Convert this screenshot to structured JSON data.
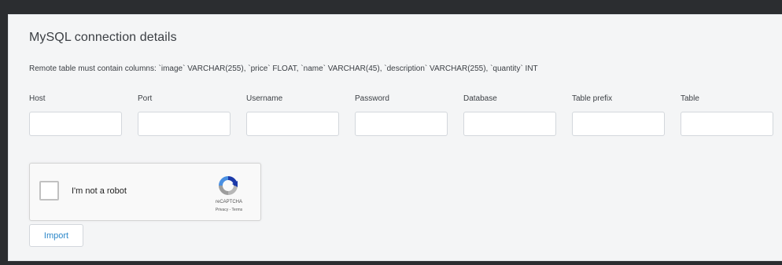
{
  "section": {
    "title": "MySQL connection details",
    "note": "Remote table must contain columns: `image` VARCHAR(255), `price` FLOAT, `name` VARCHAR(45), `description` VARCHAR(255), `quantity` INT"
  },
  "fields": [
    {
      "label": "Host",
      "value": ""
    },
    {
      "label": "Port",
      "value": ""
    },
    {
      "label": "Username",
      "value": ""
    },
    {
      "label": "Password",
      "value": ""
    },
    {
      "label": "Database",
      "value": ""
    },
    {
      "label": "Table prefix",
      "value": ""
    },
    {
      "label": "Table",
      "value": ""
    }
  ],
  "captcha": {
    "label": "I'm not a robot",
    "brand": "reCAPTCHA",
    "links": "Privacy - Terms",
    "checked": false
  },
  "actions": {
    "import_label": "Import"
  },
  "colors": {
    "background": "#2b2d30",
    "panel": "#f4f5f6",
    "accent": "#2b87c9"
  }
}
